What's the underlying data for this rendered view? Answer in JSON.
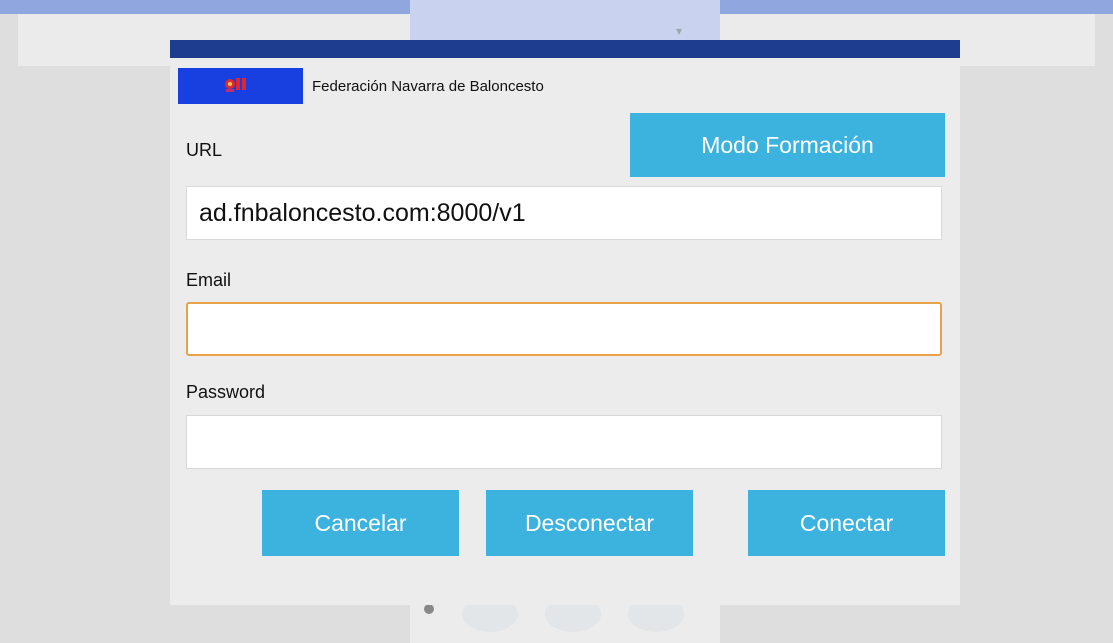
{
  "header": {
    "org_name": "Federación Navarra de Baloncesto",
    "bar_color": "#1e3d8f",
    "logo_bg": "#1840e0"
  },
  "form": {
    "url_label": "URL",
    "url_value": "ad.fnbaloncesto.com:8000/v1",
    "email_label": "Email",
    "email_value": "",
    "password_label": "Password",
    "password_value": ""
  },
  "buttons": {
    "modo_formacion": "Modo Formación",
    "cancelar": "Cancelar",
    "desconectar": "Desconectar",
    "conectar": "Conectar",
    "color": "#3cb2df"
  },
  "icons": [
    "logo-icon",
    "chevron-down-icon",
    "grid-icon"
  ]
}
